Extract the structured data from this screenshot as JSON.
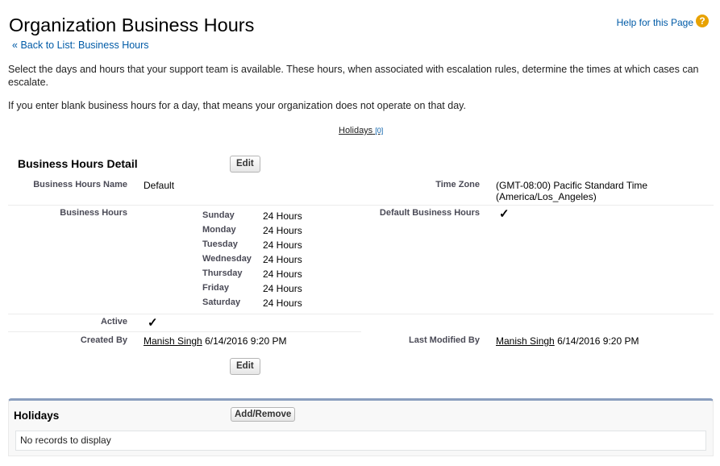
{
  "header": {
    "title": "Organization Business Hours",
    "help_label": "Help for this Page",
    "help_icon_glyph": "?",
    "back_prefix": "«",
    "back_label": "Back to List: Business Hours"
  },
  "description": {
    "line1": "Select the days and hours that your support team is available. These hours, when associated with escalation rules, determine the times at which cases can escalate.",
    "line2": "If you enter blank business hours for a day, that means your organization does not operate on that day."
  },
  "anchors": {
    "holidays_label": "Holidays",
    "holidays_count": "[0]"
  },
  "detail": {
    "section_title": "Business Hours Detail",
    "edit_label": "Edit",
    "name_label": "Business Hours Name",
    "name_value": "Default",
    "timezone_label": "Time Zone",
    "timezone_value": "(GMT-08:00) Pacific Standard Time (America/Los_Angeles)",
    "hours_label": "Business Hours",
    "default_label": "Default Business Hours",
    "default_checked": "✓",
    "days": [
      {
        "day": "Sunday",
        "hours": "24 Hours"
      },
      {
        "day": "Monday",
        "hours": "24 Hours"
      },
      {
        "day": "Tuesday",
        "hours": "24 Hours"
      },
      {
        "day": "Wednesday",
        "hours": "24 Hours"
      },
      {
        "day": "Thursday",
        "hours": "24 Hours"
      },
      {
        "day": "Friday",
        "hours": "24 Hours"
      },
      {
        "day": "Saturday",
        "hours": "24 Hours"
      }
    ],
    "active_label": "Active",
    "active_checked": "✓",
    "created_label": "Created By",
    "created_user": "Manish Singh",
    "created_date": "6/14/2016 9:20 PM",
    "modified_label": "Last Modified By",
    "modified_user": "Manish Singh",
    "modified_date": "6/14/2016 9:20 PM"
  },
  "holidays": {
    "title": "Holidays",
    "add_remove_label": "Add/Remove",
    "empty_text": "No records to display"
  },
  "colors": {
    "link": "#015ba7",
    "help_icon": "#e8a200",
    "related_border": "#8a9ebe"
  }
}
